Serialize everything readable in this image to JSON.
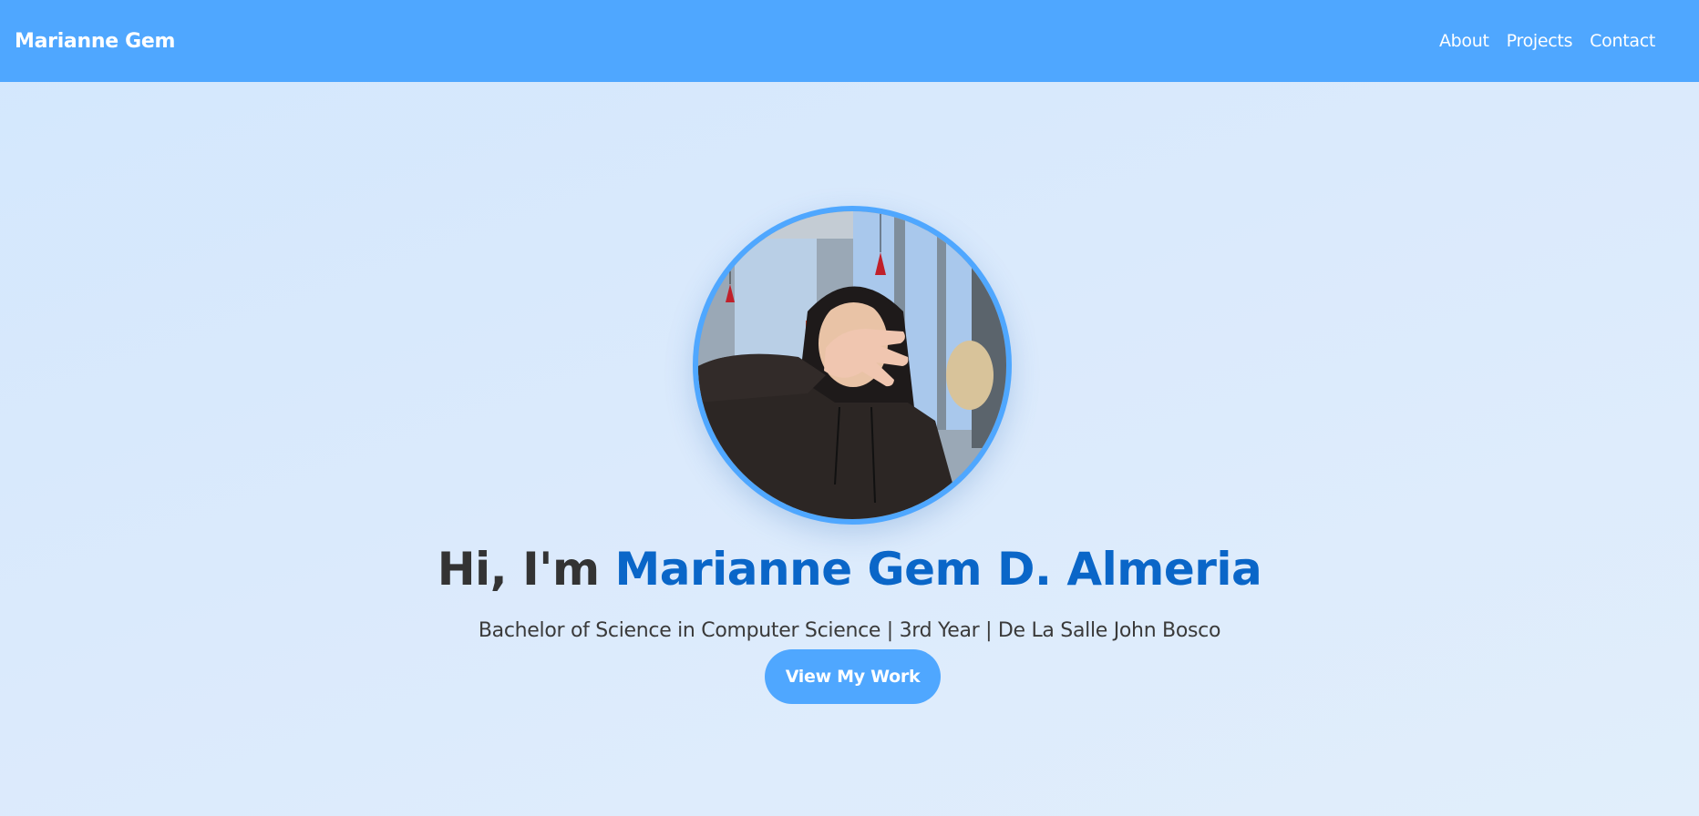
{
  "navbar": {
    "brand": "Marianne Gem",
    "links": [
      {
        "label": "About"
      },
      {
        "label": "Projects"
      },
      {
        "label": "Contact"
      }
    ],
    "background_color": "#4fa7ff"
  },
  "hero": {
    "greeting": "Hi, I'm ",
    "name": "Marianne Gem D. Almeria",
    "subtitle": "Bachelor of Science in Computer Science | 3rd Year | De La Salle John Bosco",
    "cta_label": "View My Work",
    "accent_color": "#0a66c8"
  }
}
